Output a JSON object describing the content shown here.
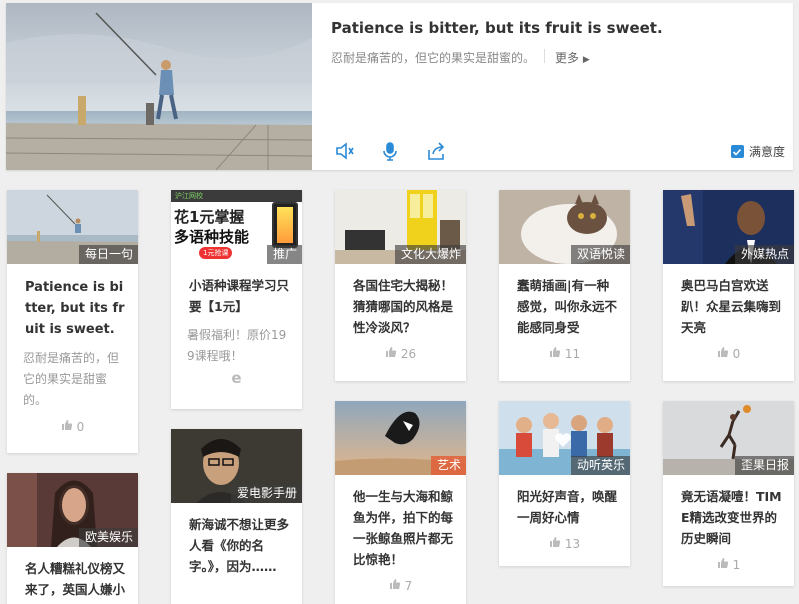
{
  "hero": {
    "english": "Patience is bitter, but its fruit is sweet.",
    "chinese": "忍耐是痛苦的，但它的果实是甜蜜的。",
    "more": "更多",
    "satisfaction": "满意度"
  },
  "cards": [
    {
      "tag": "每日一句",
      "title": "Patience is bitter, but its fruit is sweet.",
      "desc": "忍耐是痛苦的，但它的果实是甜蜜的。",
      "likes": "0"
    },
    {
      "tag": "推广",
      "title": "小语种课程学习只要【1元】",
      "desc": "暑假福利！原价199课程哦！",
      "ad_badge": "沪江网校",
      "ad_line1": "花1元掌握",
      "ad_line2": "多语种技能",
      "ad_button": "1元抢课"
    },
    {
      "tag": "文化大爆炸",
      "title": "各国住宅大揭秘！猜猜哪国的风格是性冷淡风？",
      "likes": "26"
    },
    {
      "tag": "双语悦读",
      "title": "蠢萌插画|有一种感觉，叫你永远不能感同身受",
      "likes": "11"
    },
    {
      "tag": "外媒热点",
      "title": "奥巴马白宫欢送趴！众星云集嗨到天亮",
      "likes": "0"
    },
    {
      "tag": "欧美娱乐",
      "title": "名人糟糕礼仪榜又来了，英国人嫌小"
    },
    {
      "tag": "爱电影手册",
      "title": "新海诚不想让更多人看《你的名字。》，因为……"
    },
    {
      "tag": "艺术",
      "title": "他一生与大海和鲸鱼为伴，拍下的每一张鲸鱼照片都无比惊艳！",
      "likes": "7"
    },
    {
      "tag": "动听英乐",
      "title": "阳光好声音，唤醒一周好心情",
      "likes": "13"
    },
    {
      "tag": "歪果日报",
      "title": "竟无语凝噎！TIME精选改变世界的历史瞬间",
      "likes": "1"
    }
  ]
}
